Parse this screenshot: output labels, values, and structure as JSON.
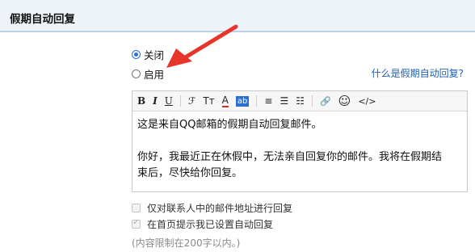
{
  "section": {
    "title": "假期自动回复"
  },
  "options": [
    {
      "label": "关闭",
      "checked": true
    },
    {
      "label": "启用",
      "checked": false
    }
  ],
  "help_link": "什么是假期自动回复?",
  "toolbar": {
    "bold": "B",
    "italic": "I",
    "underline": "U",
    "font_family_icon": "ℱ",
    "font_size_icon": "Tт",
    "font_color_icon": "A",
    "background_color_icon": "ab",
    "align_icon": "≡",
    "list_icon": "☰",
    "indent_icon": "☷",
    "link_icon": "🔗",
    "emoji_icon": "☺",
    "code_icon": "</>"
  },
  "editor": {
    "line1": "这是来自QQ邮箱的假期自动回复邮件。",
    "line2": "你好，我最近正在休假中，无法亲自回复你的邮件。我将在假期结",
    "line3": "束后，尽快给你回复。"
  },
  "checkboxes": [
    {
      "label": "仅对联系人中的邮件地址进行回复",
      "checked": false
    },
    {
      "label": "在首页提示我已设置自动回复",
      "checked": true
    }
  ],
  "limit_note": "(内容限制在200字以内。)",
  "colors": {
    "arrow": "#e8352b",
    "link": "#1f5fae",
    "radio": "#2b6fd6"
  }
}
